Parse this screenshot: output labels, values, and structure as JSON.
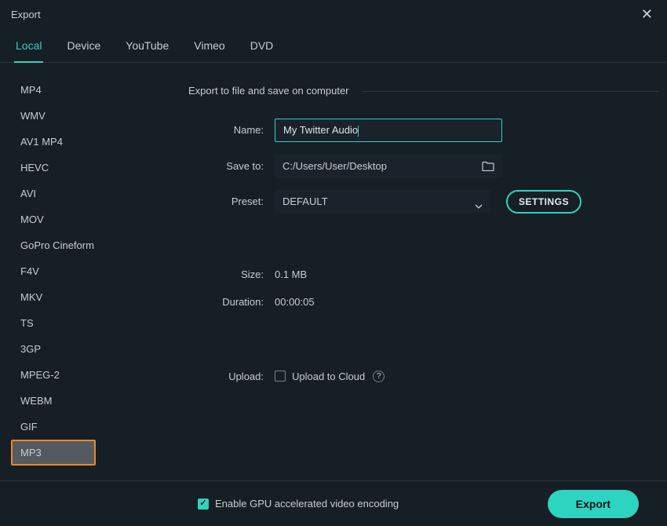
{
  "window": {
    "title": "Export"
  },
  "tabs": [
    {
      "label": "Local",
      "active": true
    },
    {
      "label": "Device",
      "active": false
    },
    {
      "label": "YouTube",
      "active": false
    },
    {
      "label": "Vimeo",
      "active": false
    },
    {
      "label": "DVD",
      "active": false
    }
  ],
  "formats": [
    "MP4",
    "WMV",
    "AV1 MP4",
    "HEVC",
    "AVI",
    "MOV",
    "GoPro Cineform",
    "F4V",
    "MKV",
    "TS",
    "3GP",
    "MPEG-2",
    "WEBM",
    "GIF",
    "MP3"
  ],
  "selectedFormat": "MP3",
  "section": {
    "heading": "Export to file and save on computer"
  },
  "fields": {
    "name_label": "Name:",
    "name_value": "My Twitter Audio",
    "saveto_label": "Save to:",
    "saveto_value": "C:/Users/User/Desktop",
    "preset_label": "Preset:",
    "preset_value": "DEFAULT",
    "settings_btn": "SETTINGS"
  },
  "info": {
    "size_label": "Size:",
    "size_value": "0.1 MB",
    "duration_label": "Duration:",
    "duration_value": "00:00:05"
  },
  "upload": {
    "label": "Upload:",
    "checkbox_label": "Upload to Cloud",
    "checked": false
  },
  "footer": {
    "gpu_checked": true,
    "gpu_label": "Enable GPU accelerated video encoding",
    "export_btn": "Export"
  }
}
